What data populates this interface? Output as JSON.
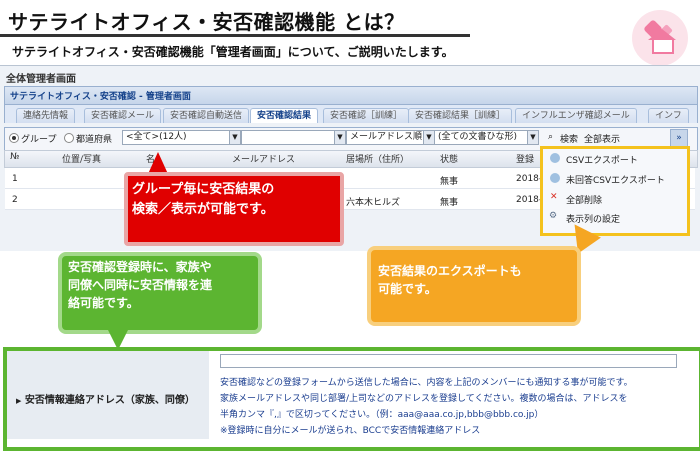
{
  "heading": {
    "title": "サテライトオフィス・安否確認機能 とは？",
    "subtitle": "サテライトオフィス・安否確認機能「管理者画面」について、ご説明いたします。"
  },
  "app": {
    "window_title": "全体管理者画面",
    "panel_title": "サテライトオフィス・安否確認 - 管理者画面",
    "tabs": [
      {
        "label": "連絡先情報",
        "active": false
      },
      {
        "label": "安否確認メール",
        "active": false
      },
      {
        "label": "安否確認自動送信",
        "active": false
      },
      {
        "label": "安否確認結果",
        "active": true
      },
      {
        "label": "安否確認［訓練］",
        "active": false
      },
      {
        "label": "安否確認結果［訓練］",
        "active": false
      },
      {
        "label": "インフルエンザ確認メール",
        "active": false
      },
      {
        "label": "インフ",
        "active": false
      }
    ],
    "toolbar": {
      "radio_group": "グループ",
      "radio_prefecture": "都道府県",
      "group_select": "<全て>(12人)",
      "blank_select": "",
      "sort_select": "メールアドレス順",
      "text_filter_select": "(全ての文書ひな形)",
      "search_label": "検索",
      "show_all_label": "全部表示",
      "expand_label": "»"
    },
    "grid": {
      "headers": [
        "№",
        "位置/写真",
        "名",
        "メールアドレス",
        "居場所（住所）",
        "状態",
        "登録"
      ],
      "rows": [
        {
          "no": "1",
          "location": "",
          "status": "無事",
          "date": "2018-"
        },
        {
          "no": "2",
          "location": "六本木ヒルズ",
          "status": "無事",
          "date": "2018-"
        }
      ]
    },
    "context_menu": [
      {
        "label": "CSVエクスポート",
        "icon": "export-icon"
      },
      {
        "label": "未回答CSVエクスポート",
        "icon": "export-icon"
      },
      {
        "label": "全部削除",
        "icon": "delete-x-icon"
      },
      {
        "label": "表示列の設定",
        "icon": "gear-icon"
      }
    ]
  },
  "callouts": {
    "red": [
      "グループ毎に安否結果の",
      "検索／表示が可能です。"
    ],
    "orange": [
      "安否結果のエクスポートも",
      "可能です。"
    ],
    "green": [
      "安否確認登録時に、家族や",
      "同僚へ同時に安否情報を連",
      "絡可能です。"
    ]
  },
  "form": {
    "label": "安否情報連絡アドレス（家族、同僚）",
    "input_value": "",
    "notes": [
      "安否確認などの登録フォームから送信した場合に、内容を上記のメンバーにも通知する事が可能です。",
      "家族メールアドレスや同じ部署/上司などのアドレスを登録してください。複数の場合は、アドレスを",
      "半角カンマ『,』で区切ってください。（例：aaa@aaa.co.jp,bbb@bbb.co.jp）",
      "※登録時に自分にメールが送られ、BCCで安否情報連絡アドレス"
    ]
  },
  "colors": {
    "red_callout": "#e00000",
    "orange_callout": "#f5a623",
    "green_callout": "#5cb531",
    "menu_border": "#f4c21d"
  }
}
